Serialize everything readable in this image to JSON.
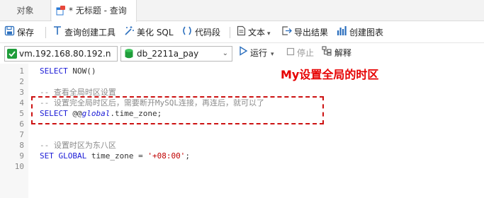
{
  "tabs": {
    "objects": "对象",
    "query": "* 无标题 - 查询"
  },
  "toolbar1": {
    "save": "保存",
    "query_builder": "查询创建工具",
    "beautify": "美化 SQL",
    "code_snippet": "代码段",
    "text": "文本",
    "export": "导出结果",
    "create_chart": "创建图表"
  },
  "toolbar2": {
    "connection": "vm.192.168.80.192.n",
    "database": "db_2211a_pay",
    "run": "运行",
    "stop": "停止",
    "explain": "解释"
  },
  "editor": {
    "line_numbers": [
      "1",
      "2",
      "3",
      "4",
      "5",
      "6",
      "7",
      "8",
      "9",
      "10"
    ],
    "line1_kw": "SELECT",
    "line1_rest": " NOW()",
    "line3": "-- 查看全局时区设置",
    "line4": "-- 设置完全局时区后，需要断开MySQL连接，再连后，就可以了",
    "line5_kw": "SELECT",
    "line5_at": " @@",
    "line5_var": "global",
    "line5_rest": ".time_zone;",
    "line8": "-- 设置时区为东八区",
    "line9_kw": "SET GLOBAL",
    "line9_mid": " time_zone = ",
    "line9_str": "'+08:00'",
    "line9_end": ";"
  },
  "annotation": "My设置全局的时区",
  "colors": {
    "keyword": "#1a1ad6",
    "comment": "#8b8b8b",
    "string": "#c00000",
    "annotation": "#e60000"
  }
}
